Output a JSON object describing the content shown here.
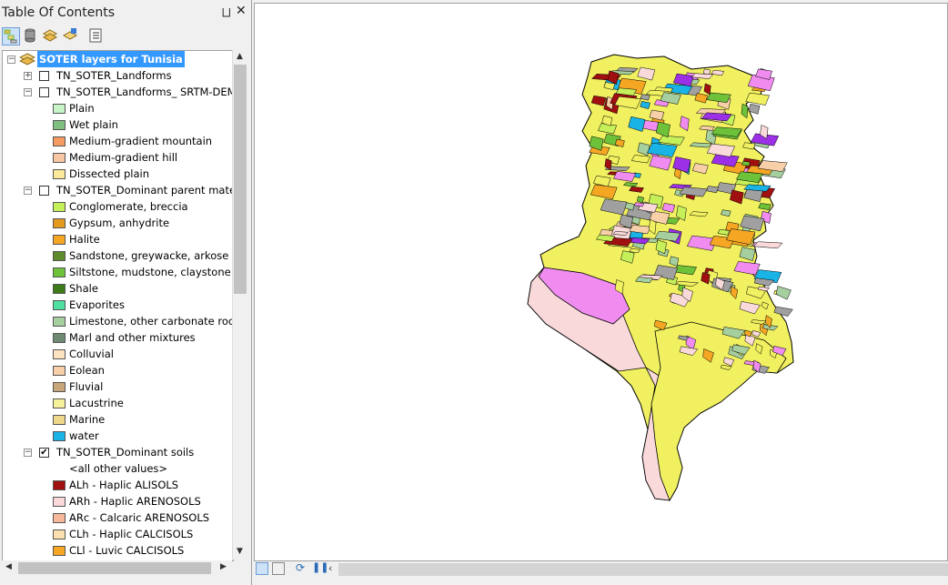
{
  "toc": {
    "title": "Table Of Contents",
    "pin_glyph": "⨆",
    "close_glyph": "✕",
    "toolbar": [
      {
        "name": "list-by-drawing-order-icon",
        "active": true
      },
      {
        "name": "list-by-source-icon",
        "active": false
      },
      {
        "name": "list-by-visibility-icon",
        "active": false
      },
      {
        "name": "list-by-selection-icon",
        "active": false
      },
      {
        "name": "options-icon",
        "active": false
      }
    ]
  },
  "tree": {
    "root_label": "SOTER layers for Tunisia",
    "rows": [
      {
        "kind": "layer",
        "label": "TN_SOTER_Landforms",
        "expander": "+",
        "checked": false
      },
      {
        "kind": "layer",
        "label": "TN_SOTER_Landforms_ SRTM-DEM",
        "expander": "−",
        "checked": false
      },
      {
        "kind": "class",
        "label": "Plain",
        "color": "#c8f5c8"
      },
      {
        "kind": "class",
        "label": "Wet plain",
        "color": "#7fbf7f"
      },
      {
        "kind": "class",
        "label": "Medium-gradient mountain",
        "color": "#f59a61"
      },
      {
        "kind": "class",
        "label": "Medium-gradient hill",
        "color": "#f7c6a3"
      },
      {
        "kind": "class",
        "label": "Dissected plain",
        "color": "#fbe89a"
      },
      {
        "kind": "layer",
        "label": "TN_SOTER_Dominant parent materia",
        "expander": "−",
        "checked": false
      },
      {
        "kind": "class",
        "label": "Conglomerate, breccia",
        "color": "#c6f05a"
      },
      {
        "kind": "class",
        "label": "Gypsum, anhydrite",
        "color": "#e39a1e"
      },
      {
        "kind": "class",
        "label": "Halite",
        "color": "#f5a623"
      },
      {
        "kind": "class",
        "label": "Sandstone, greywacke, arkose",
        "color": "#5f8a2e"
      },
      {
        "kind": "class",
        "label": "Siltstone, mudstone, claystone",
        "color": "#6dc23a"
      },
      {
        "kind": "class",
        "label": "Shale",
        "color": "#3d7a1a"
      },
      {
        "kind": "class",
        "label": "Evaporites",
        "color": "#4de0a0"
      },
      {
        "kind": "class",
        "label": "Limestone, other carbonate rocks",
        "color": "#a6cfa0"
      },
      {
        "kind": "class",
        "label": "Marl and other mixtures",
        "color": "#6f8a72"
      },
      {
        "kind": "class",
        "label": "Colluvial",
        "color": "#fde2c2"
      },
      {
        "kind": "class",
        "label": "Eolean",
        "color": "#f7cfa8"
      },
      {
        "kind": "class",
        "label": "Fluvial",
        "color": "#c9a57a"
      },
      {
        "kind": "class",
        "label": "Lacustrine",
        "color": "#f5f09a"
      },
      {
        "kind": "class",
        "label": "Marine",
        "color": "#f0d88a"
      },
      {
        "kind": "class",
        "label": "water",
        "color": "#1ab3e6"
      },
      {
        "kind": "layer",
        "label": "TN_SOTER_Dominant soils",
        "expander": "−",
        "checked": true
      },
      {
        "kind": "text",
        "label": "<all other values>"
      },
      {
        "kind": "class",
        "label": "ALh  -  Haplic ALISOLS",
        "color": "#a01010"
      },
      {
        "kind": "class",
        "label": "ARh  -  Haplic ARENOSOLS",
        "color": "#f9d9d9"
      },
      {
        "kind": "class",
        "label": "ARc - Calcaric ARENOSOLS",
        "color": "#f7b89a"
      },
      {
        "kind": "class",
        "label": "CLh  -  Haplic CALCISOLS",
        "color": "#fde0b0"
      },
      {
        "kind": "class",
        "label": "CLl  -  Luvic CALCISOLS",
        "color": "#f5a623"
      }
    ]
  },
  "map": {
    "shape_outline": "#000000",
    "palette": [
      "#f0f060",
      "#f5a623",
      "#f08cf0",
      "#f9d9d9",
      "#a0a0a0",
      "#a6cfa0",
      "#c6f05a",
      "#1ab3e6",
      "#9b30e6",
      "#a01010",
      "#f7cfa8",
      "#6dc23a"
    ]
  },
  "bottom": {
    "buttons": [
      "layout-view-icon",
      "data-view-icon",
      "refresh-icon",
      "pause-icon",
      "scroll-left-icon"
    ]
  }
}
